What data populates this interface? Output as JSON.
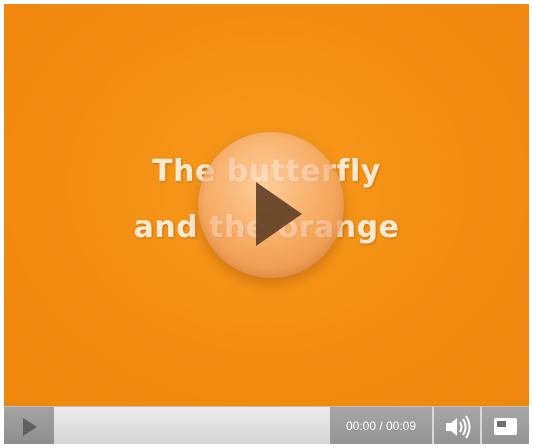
{
  "video": {
    "title_line1": "The butterfly",
    "title_line2": "and the orange",
    "background_color": "#f0890f"
  },
  "overlay": {
    "icon": "play-icon"
  },
  "controls": {
    "play_icon": "play-icon",
    "time_display": "00:00 / 00:09",
    "current_time": "00:00",
    "duration": "00:09",
    "progress_fraction": 0,
    "volume_icon": "speaker-icon",
    "fullscreen_icon": "fullscreen-icon"
  }
}
